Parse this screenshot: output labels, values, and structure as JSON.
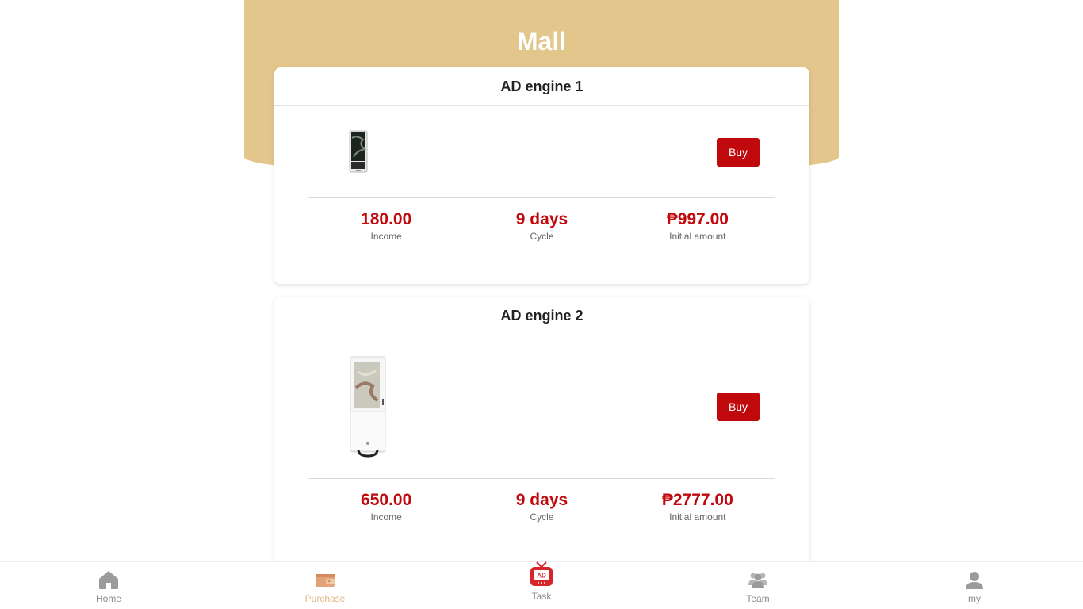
{
  "header": {
    "title": "Mall"
  },
  "products": [
    {
      "name": "AD engine 1",
      "buy_label": "Buy",
      "income": "180.00",
      "income_label": "Income",
      "cycle": "9 days",
      "cycle_label": "Cycle",
      "amount": "₱997.00",
      "amount_label": "Initial amount"
    },
    {
      "name": "AD engine 2",
      "buy_label": "Buy",
      "income": "650.00",
      "income_label": "Income",
      "cycle": "9 days",
      "cycle_label": "Cycle",
      "amount": "₱2777.00",
      "amount_label": "Initial amount"
    }
  ],
  "tabbar": {
    "items": [
      {
        "label": "Home",
        "icon": "home-icon",
        "active": false
      },
      {
        "label": "Purchase",
        "icon": "wallet-icon",
        "active": true
      },
      {
        "label": "Task",
        "icon": "ad-tv-icon",
        "active": false
      },
      {
        "label": "Team",
        "icon": "team-icon",
        "active": false
      },
      {
        "label": "my",
        "icon": "user-icon",
        "active": false
      }
    ]
  },
  "colors": {
    "brand_gold": "#e3c68b",
    "accent_red": "#c0090d",
    "active_tab": "#e2b986",
    "inactive_tab": "#8a8a8a"
  }
}
